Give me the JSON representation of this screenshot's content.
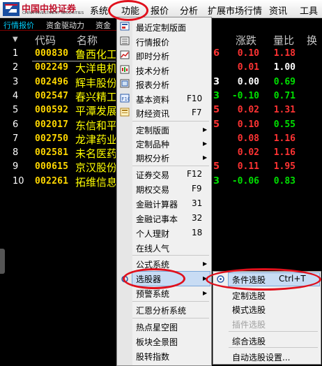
{
  "app": {
    "logo_cn": "中国中投证券",
    "logo_en": "CHINA INVESTMENT SECURITIES"
  },
  "menubar": [
    "系统",
    "功能",
    "报价",
    "分析",
    "扩展市场行情",
    "资讯",
    "工具"
  ],
  "tabs": [
    "行情报价",
    "资金驱动力",
    "资金"
  ],
  "table": {
    "headers": [
      "代码",
      "名称",
      "涨跌",
      "量比",
      "换"
    ],
    "rows": [
      {
        "idx": "1",
        "code": "000830",
        "name": "鲁西化工",
        "edge": "6",
        "chg": "0.10",
        "ratio": "1.18"
      },
      {
        "idx": "2",
        "code": "002249",
        "name": "大洋电机",
        "edge": "",
        "chg": "0.01",
        "ratio": "1.00"
      },
      {
        "idx": "3",
        "code": "002496",
        "name": "辉丰股份",
        "edge": "3",
        "chg": "0.00",
        "ratio": "0.69"
      },
      {
        "idx": "4",
        "code": "002547",
        "name": "春兴精工",
        "edge": "3",
        "chg": "-0.10",
        "ratio": "0.71"
      },
      {
        "idx": "5",
        "code": "000592",
        "name": "平潭发展",
        "edge": "5",
        "chg": "0.02",
        "ratio": "1.31"
      },
      {
        "idx": "6",
        "code": "002017",
        "name": "东信和平",
        "edge": "5",
        "chg": "0.10",
        "ratio": "0.55"
      },
      {
        "idx": "7",
        "code": "002750",
        "name": "龙津药业",
        "edge": "",
        "chg": "0.08",
        "ratio": "1.16"
      },
      {
        "idx": "8",
        "code": "002581",
        "name": "未名医药",
        "edge": "",
        "chg": "0.02",
        "ratio": "1.16"
      },
      {
        "idx": "9",
        "code": "000615",
        "name": "京汉股份",
        "edge": "5",
        "chg": "0.11",
        "ratio": "1.95"
      },
      {
        "idx": "10",
        "code": "002261",
        "name": "拓维信息",
        "edge": "3",
        "chg": "-0.06",
        "ratio": "0.83"
      }
    ]
  },
  "dropdown": {
    "items": [
      {
        "label": "最近定制版面",
        "shortcut": "",
        "arrow": false
      },
      {
        "label": "行情报价",
        "shortcut": "",
        "arrow": false
      },
      {
        "label": "即时分析",
        "shortcut": "",
        "arrow": false
      },
      {
        "label": "技术分析",
        "shortcut": "",
        "arrow": false
      },
      {
        "label": "报表分析",
        "shortcut": "",
        "arrow": false
      },
      {
        "label": "基本资料",
        "shortcut": "F10",
        "arrow": false
      },
      {
        "label": "财经资讯",
        "shortcut": "F7",
        "arrow": false
      },
      {
        "label": "定制版面",
        "shortcut": "",
        "arrow": true
      },
      {
        "label": "定制品种",
        "shortcut": "",
        "arrow": true
      },
      {
        "label": "期权分析",
        "shortcut": "",
        "arrow": true
      },
      {
        "label": "证券交易",
        "shortcut": "F12",
        "arrow": false
      },
      {
        "label": "期权交易",
        "shortcut": "F9",
        "arrow": false
      },
      {
        "label": "金融计算器",
        "shortcut": "31",
        "arrow": false
      },
      {
        "label": "金融记事本",
        "shortcut": "32",
        "arrow": false
      },
      {
        "label": "个人理财",
        "shortcut": "18",
        "arrow": false
      },
      {
        "label": "在线人气",
        "shortcut": "",
        "arrow": false
      },
      {
        "label": "公式系统",
        "shortcut": "",
        "arrow": true
      },
      {
        "label": "选股器",
        "shortcut": "",
        "arrow": true
      },
      {
        "label": "预警系统",
        "shortcut": "",
        "arrow": true
      },
      {
        "label": "汇恩分析系统",
        "shortcut": "",
        "arrow": false
      },
      {
        "label": "热点星空图",
        "shortcut": "",
        "arrow": false
      },
      {
        "label": "板块全景图",
        "shortcut": "",
        "arrow": false
      },
      {
        "label": "股转指数",
        "shortcut": "",
        "arrow": false
      }
    ]
  },
  "submenu": {
    "items": [
      {
        "label": "条件选股",
        "shortcut": "Ctrl+T",
        "disabled": false
      },
      {
        "label": "定制选股",
        "shortcut": "",
        "disabled": false
      },
      {
        "label": "模式选股",
        "shortcut": "",
        "disabled": false
      },
      {
        "label": "插件选股",
        "shortcut": "",
        "disabled": true
      },
      {
        "label": "综合选股",
        "shortcut": "",
        "disabled": false
      },
      {
        "label": "自动选股设置...",
        "shortcut": "",
        "disabled": false
      }
    ]
  },
  "colors": {
    "up": "#ff3333",
    "down": "#00e000",
    "code": "#ffd700",
    "name": "#ffff00",
    "highlight": "#e0101c"
  }
}
